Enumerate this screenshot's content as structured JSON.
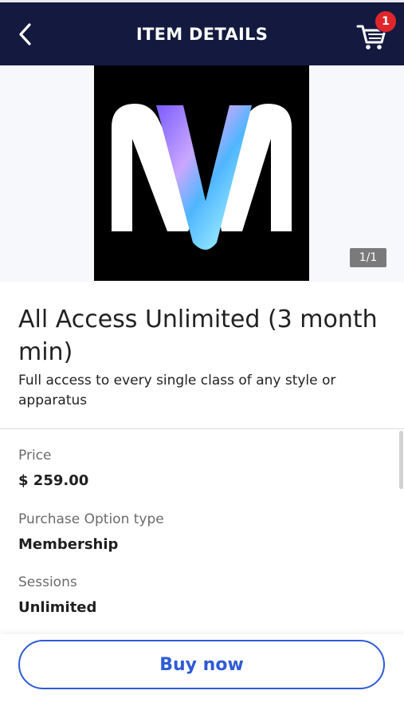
{
  "header": {
    "title": "ITEM DETAILS",
    "cart_count": "1"
  },
  "gallery": {
    "counter": "1/1"
  },
  "item": {
    "title": "All Access Unlimited (3 month min)",
    "description": "Full access to every single class of any style or apparatus"
  },
  "details": [
    {
      "label": "Price",
      "value": "$ 259.00"
    },
    {
      "label": "Purchase Option type",
      "value": "Membership"
    },
    {
      "label": "Sessions",
      "value": "Unlimited"
    }
  ],
  "actions": {
    "buy_label": "Buy now"
  },
  "colors": {
    "header_bg": "#141a3f",
    "badge": "#e0262b",
    "accent": "#2e5bd6"
  },
  "icons": {
    "back": "chevron-left-icon",
    "cart": "shopping-cart-icon"
  }
}
